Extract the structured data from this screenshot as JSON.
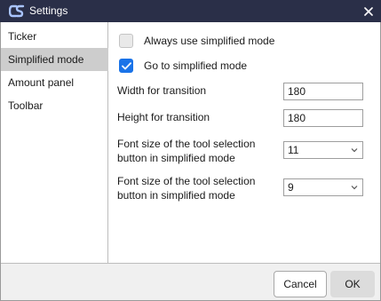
{
  "window": {
    "title": "Settings",
    "title_bar_color": "#2a2f48",
    "app_icon": "app-logo-icon",
    "close_icon": "close-icon"
  },
  "sidebar": {
    "items": [
      {
        "label": "Ticker",
        "selected": false
      },
      {
        "label": "Simplified mode",
        "selected": true
      },
      {
        "label": "Amount panel",
        "selected": false
      },
      {
        "label": "Toolbar",
        "selected": false
      }
    ],
    "selected_color": "#cdcdcd"
  },
  "simplified_mode": {
    "always_use": {
      "label": "Always use simplified mode",
      "checked": false
    },
    "go_to": {
      "label": "Go to simplified mode",
      "checked": true
    },
    "width_for_transition": {
      "label": "Width for transition",
      "value": "180"
    },
    "height_for_transition": {
      "label": "Height for transition",
      "value": "180"
    },
    "font_size_1": {
      "label_line1": "Font size of the tool selection",
      "label_line2": "button in simplified mode",
      "value": "11"
    },
    "font_size_2": {
      "label_line1": "Font size of the tool selection",
      "label_line2": "button in simplified mode",
      "value": "9"
    },
    "checkbox_accent": "#1a73e8"
  },
  "footer": {
    "cancel_label": "Cancel",
    "ok_label": "OK"
  }
}
